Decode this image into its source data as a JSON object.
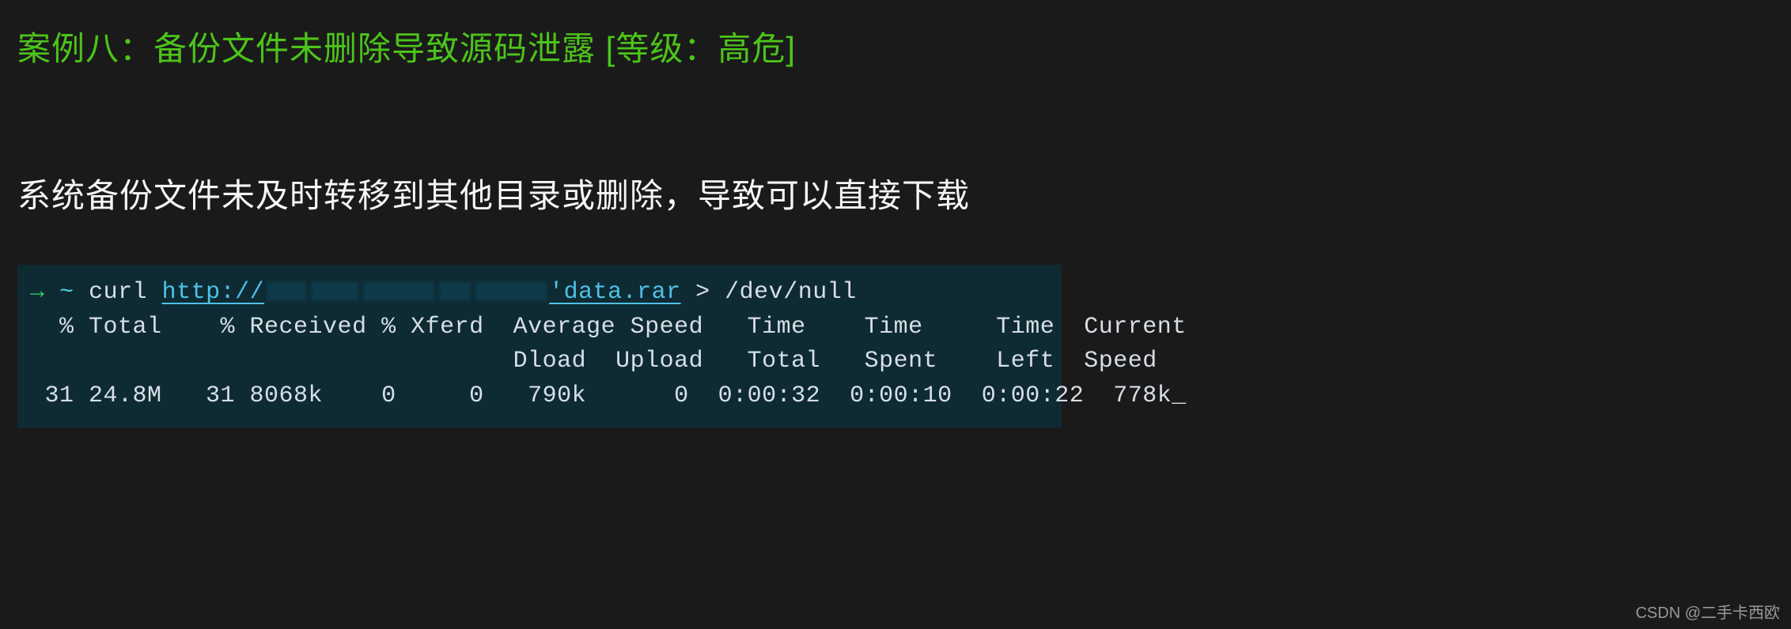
{
  "heading": "案例八：备份文件未删除导致源码泄露 [等级：高危]",
  "description": "系统备份文件未及时转移到其他目录或删除，导致可以直接下载",
  "terminal": {
    "prompt_arrow": "→",
    "prompt_tilde": "~",
    "command": "curl",
    "url_scheme": "http://",
    "url_file": "'data.rar",
    "redirect": "> /dev/null",
    "header1": "  % Total    % Received % Xferd  Average Speed   Time    Time     Time  Current",
    "header2": "                                 Dload  Upload   Total   Spent    Left  Speed",
    "data_row": " 31 24.8M   31 8068k    0     0   790k      0  0:00:32  0:00:10  0:00:22  778k",
    "cursor": "_"
  },
  "watermark": "CSDN @二手卡西欧"
}
